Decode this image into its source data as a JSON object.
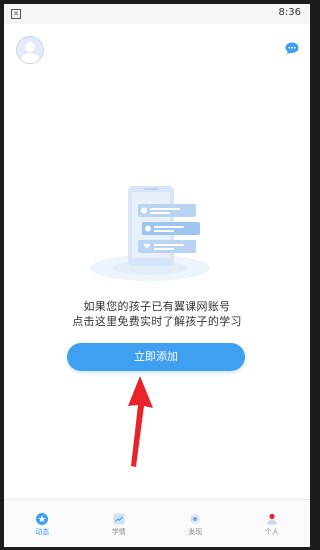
{
  "status_bar": {
    "time": "8:36",
    "notification_icon": "notification-icon"
  },
  "header": {
    "avatar_icon": "user-avatar",
    "chat_icon": "chat-bubble-icon"
  },
  "empty_state": {
    "line1": "如果您的孩子已有翼课网账号",
    "line2": "点击这里免费实时了解孩子的学习",
    "button_label": "立即添加"
  },
  "tabs": [
    {
      "label": "动态",
      "icon": "star-icon",
      "active": true
    },
    {
      "label": "学情",
      "icon": "trend-chart-icon",
      "active": false
    },
    {
      "label": "发现",
      "icon": "discover-icon",
      "active": false
    },
    {
      "label": "个人",
      "icon": "person-icon",
      "active": false
    }
  ],
  "colors": {
    "accent": "#3f9ff0",
    "annotation_arrow": "#e8232a"
  }
}
